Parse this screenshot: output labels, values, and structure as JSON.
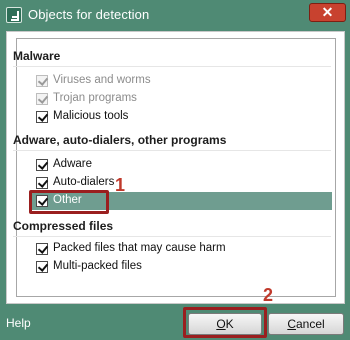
{
  "window": {
    "title": "Objects for detection",
    "close_glyph": "✕",
    "accent_color": "#4f8a74"
  },
  "sections": [
    {
      "title": "Malware",
      "items": [
        {
          "label": "Viruses and worms",
          "checked": true,
          "disabled": true
        },
        {
          "label": "Trojan programs",
          "checked": true,
          "disabled": true
        },
        {
          "label": "Malicious tools",
          "checked": true,
          "disabled": false
        }
      ]
    },
    {
      "title": "Adware, auto-dialers, other programs",
      "items": [
        {
          "label": "Adware",
          "checked": true,
          "disabled": false
        },
        {
          "label": "Auto-dialers",
          "checked": true,
          "disabled": false
        },
        {
          "label": "Other",
          "checked": true,
          "disabled": false,
          "selected": true
        }
      ]
    },
    {
      "title": "Compressed files",
      "items": [
        {
          "label": "Packed files that may cause harm",
          "checked": true,
          "disabled": false
        },
        {
          "label": "Multi-packed files",
          "checked": true,
          "disabled": false
        }
      ]
    }
  ],
  "annotations": {
    "step1": "1",
    "step2": "2",
    "color": "#c0392b"
  },
  "footer": {
    "help_label": "Help",
    "ok_label_mnemonic": "O",
    "ok_label_rest": "K",
    "cancel_label_mnemonic": "C",
    "cancel_label_rest": "ancel"
  }
}
